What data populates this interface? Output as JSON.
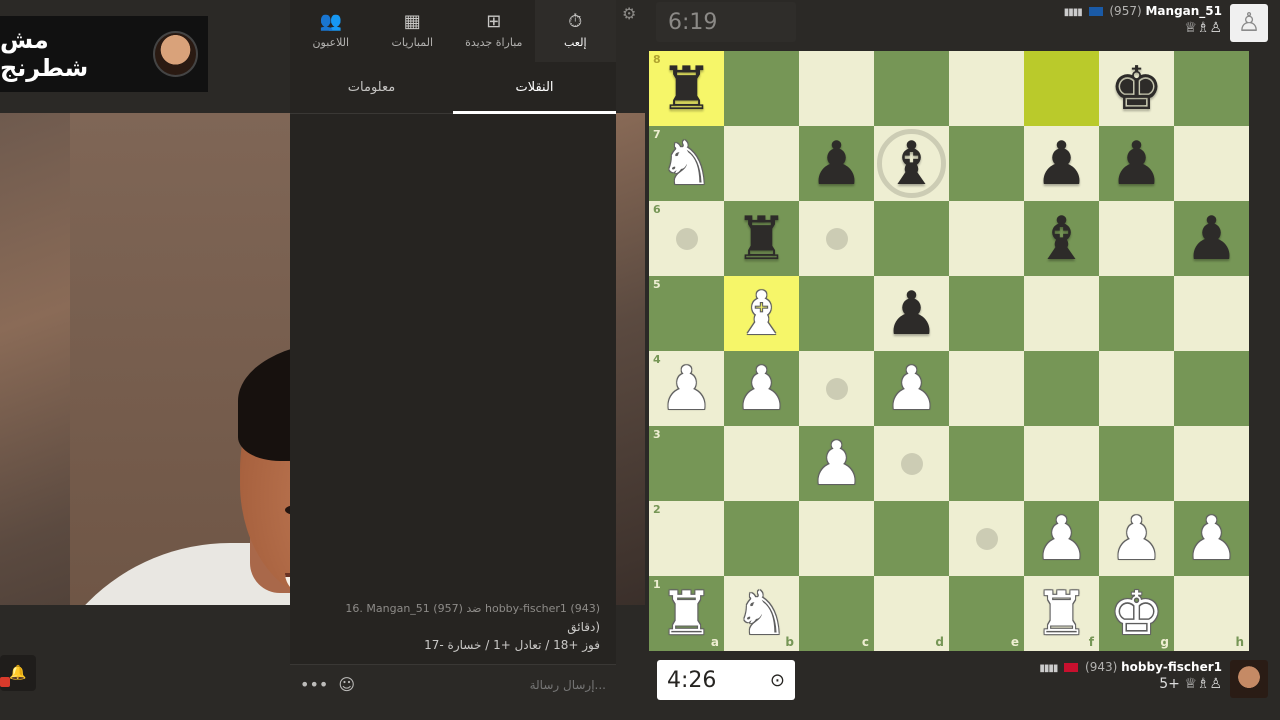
{
  "channel": {
    "name": "مش شطرنج"
  },
  "nav": {
    "items": [
      {
        "label": "اللاعبون",
        "icon": "players-icon",
        "glyph": "👥"
      },
      {
        "label": "المباريات",
        "icon": "games-icon",
        "glyph": "▦"
      },
      {
        "label": "مباراة جديدة",
        "icon": "plus-icon",
        "glyph": "⊞"
      },
      {
        "label": "إلعب",
        "icon": "stopwatch-icon",
        "glyph": "⏱"
      }
    ]
  },
  "tabs": {
    "info": "معلومات",
    "moves": "النقلات"
  },
  "chat": {
    "line1": "16. Mangan_51 (957) ضد hobby-fischer1 (943)",
    "line2": "دقائق)",
    "line3": "فوز +18 / تعادل +1 / خسارة -17",
    "placeholder": "إرسال رسالة...",
    "more": "•••",
    "emoji": "☺"
  },
  "top_player": {
    "name": "Mangan_51",
    "rating": "(957)",
    "bars": "▮▮▮▮",
    "flag_color": "#1a5aa6",
    "captured": "♕♗♙",
    "avatar_glyph": "♙"
  },
  "bottom_player": {
    "name": "hobby-fischer1",
    "rating": "(943)",
    "bars": "▮▮▮▮",
    "flag_color": "#c8102e",
    "captured": "♕♗♙",
    "material": "5+"
  },
  "clocks": {
    "top": "6:19",
    "bottom": "4:26"
  },
  "board": {
    "files": [
      "a",
      "b",
      "c",
      "d",
      "e",
      "f",
      "g",
      "h"
    ],
    "ranks": [
      "8",
      "7",
      "6",
      "5",
      "4",
      "3",
      "2",
      "1"
    ],
    "highlight": [
      "a8",
      "f8",
      "b5"
    ],
    "pieces": {
      "a8": "bR",
      "g8": "bK",
      "a7": "wN",
      "c7": "bP",
      "d7": "bB",
      "f7": "bP",
      "g7": "bP",
      "b6": "bR",
      "f6": "bB",
      "h6": "bP",
      "b5": "wB",
      "d5": "bP",
      "a4": "wP",
      "b4": "wP",
      "d4": "wP",
      "c3": "wP",
      "f2": "wP",
      "g2": "wP",
      "h2": "wP",
      "a1": "wR",
      "b1": "wN",
      "f1": "wR",
      "g1": "wK"
    },
    "dots": [
      "a6",
      "c6",
      "c4",
      "d3",
      "e2"
    ],
    "rings": [
      "d7"
    ]
  }
}
